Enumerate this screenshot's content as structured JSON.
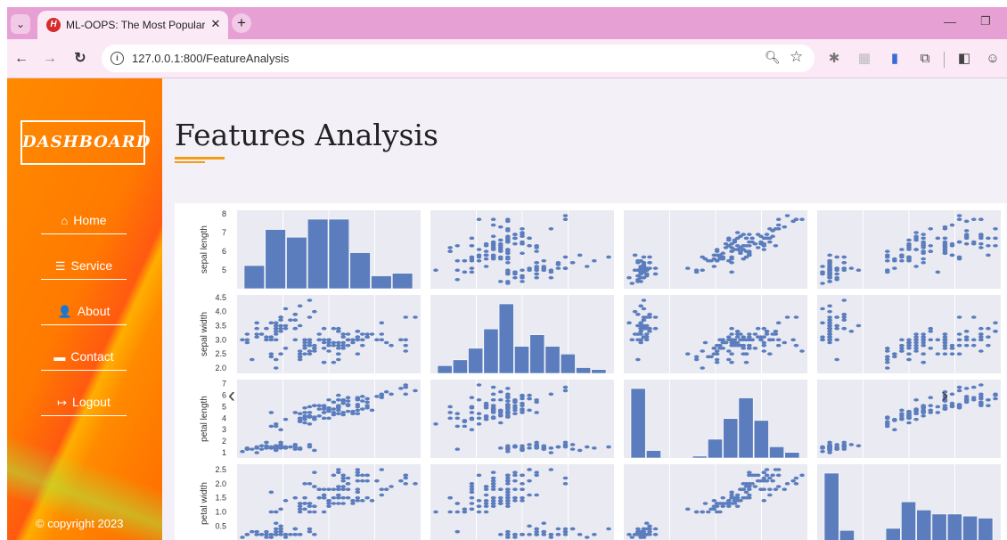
{
  "browser": {
    "tab_title": "ML-OOPS: The Most Popular V",
    "tab_close": "✕",
    "new_tab": "+",
    "url": "127.0.0.1:800/FeatureAnalysis"
  },
  "sidebar": {
    "logo": "DASHBOARD",
    "items": [
      {
        "label": "Home",
        "icon": "home-icon",
        "glyph": "⌂"
      },
      {
        "label": "Service",
        "icon": "list-icon",
        "glyph": "☰"
      },
      {
        "label": "About",
        "icon": "user-icon",
        "glyph": "👤"
      },
      {
        "label": "Contact",
        "icon": "chat-icon",
        "glyph": "▬"
      },
      {
        "label": "Logout",
        "icon": "logout-icon",
        "glyph": "↦"
      }
    ],
    "copyright": "© copyright 2023"
  },
  "main": {
    "title": "Features Analysis"
  },
  "colors": {
    "accent": "#f39c12",
    "marker": "#5b7dbd",
    "panel_bg": "#e9eaf2"
  },
  "chart_data": {
    "type": "scatter",
    "variables": [
      "sepal length",
      "sepal width",
      "petal length",
      "petal width"
    ],
    "ranges": [
      [
        4.3,
        7.9
      ],
      [
        2.0,
        4.4
      ],
      [
        1.0,
        6.9
      ],
      [
        0.1,
        2.5
      ]
    ],
    "ticks": {
      "sepal length": [
        "5",
        "6",
        "7",
        "8"
      ],
      "sepal width": [
        "2.0",
        "2.5",
        "3.0",
        "3.5",
        "4.0",
        "4.5"
      ],
      "petal length": [
        "1",
        "2",
        "3",
        "4",
        "5",
        "6",
        "7"
      ],
      "petal width": [
        "0.5",
        "1.0",
        "1.5",
        "2.0",
        "2.5"
      ]
    },
    "histograms": {
      "sepal length": [
        9,
        23,
        20,
        27,
        27,
        14,
        5,
        6
      ],
      "sepal width": [
        4,
        7,
        13,
        23,
        36,
        14,
        20,
        14,
        10,
        3,
        2
      ],
      "petal length": [
        37,
        4,
        0,
        0,
        1,
        10,
        21,
        32,
        20,
        6,
        3
      ],
      "petal width": [
        34,
        6,
        0,
        0,
        7,
        20,
        16,
        14,
        14,
        13,
        12
      ]
    },
    "samples": {
      "sepal length": [
        5.1,
        4.9,
        4.7,
        4.6,
        5.0,
        5.4,
        4.6,
        5.0,
        4.4,
        4.9,
        5.4,
        4.8,
        4.8,
        4.3,
        5.8,
        5.7,
        5.4,
        5.1,
        5.7,
        5.1,
        5.4,
        5.1,
        4.6,
        5.1,
        4.8,
        5.0,
        5.0,
        5.2,
        5.2,
        4.7,
        4.8,
        5.4,
        5.2,
        5.5,
        4.9,
        5.0,
        5.5,
        4.9,
        4.4,
        5.1,
        5.0,
        4.5,
        4.4,
        5.0,
        5.1,
        4.8,
        5.1,
        4.6,
        5.3,
        5.0,
        7.0,
        6.4,
        6.9,
        5.5,
        6.5,
        5.7,
        6.3,
        4.9,
        6.6,
        5.2,
        5.0,
        5.9,
        6.0,
        6.1,
        5.6,
        6.7,
        5.6,
        5.8,
        6.2,
        5.6,
        5.9,
        6.1,
        6.3,
        6.1,
        6.4,
        6.6,
        6.8,
        6.7,
        6.0,
        5.7,
        5.5,
        5.5,
        5.8,
        6.0,
        5.4,
        6.0,
        6.7,
        6.3,
        5.6,
        5.5,
        5.5,
        6.1,
        5.8,
        5.0,
        5.6,
        5.7,
        5.7,
        6.2,
        5.1,
        5.7,
        6.3,
        5.8,
        7.1,
        6.3,
        6.5,
        7.6,
        4.9,
        7.3,
        6.7,
        7.2,
        6.5,
        6.4,
        6.8,
        5.7,
        5.8,
        6.4,
        6.5,
        7.7,
        7.7,
        6.0,
        6.9,
        5.6,
        7.7,
        6.3,
        6.7,
        7.2,
        6.2,
        6.1,
        6.4,
        7.2,
        7.4,
        7.9,
        6.4,
        6.3,
        6.1,
        7.7,
        6.3,
        6.4,
        6.0,
        6.9,
        6.7,
        6.9,
        5.8,
        6.8,
        6.7,
        6.7,
        6.3,
        6.5,
        6.2,
        5.9
      ],
      "sepal width": [
        3.5,
        3.0,
        3.2,
        3.1,
        3.6,
        3.9,
        3.4,
        3.4,
        2.9,
        3.1,
        3.7,
        3.4,
        3.0,
        3.0,
        4.0,
        4.4,
        3.9,
        3.5,
        3.8,
        3.8,
        3.4,
        3.7,
        3.6,
        3.3,
        3.4,
        3.0,
        3.4,
        3.5,
        3.4,
        3.2,
        3.1,
        3.4,
        4.1,
        4.2,
        3.1,
        3.2,
        3.5,
        3.6,
        3.0,
        3.4,
        3.5,
        2.3,
        3.2,
        3.5,
        3.8,
        3.0,
        3.8,
        3.2,
        3.7,
        3.3,
        3.2,
        3.2,
        3.1,
        2.3,
        2.8,
        2.8,
        3.3,
        2.4,
        2.9,
        2.7,
        2.0,
        3.0,
        2.2,
        2.9,
        2.9,
        3.1,
        3.0,
        2.7,
        2.2,
        2.5,
        3.2,
        2.8,
        2.5,
        2.8,
        2.9,
        3.0,
        2.8,
        3.0,
        2.9,
        2.6,
        2.4,
        2.4,
        2.7,
        2.7,
        3.0,
        3.4,
        3.1,
        2.3,
        3.0,
        2.5,
        2.6,
        3.0,
        2.6,
        2.3,
        2.7,
        3.0,
        2.9,
        2.9,
        2.5,
        2.8,
        3.3,
        2.7,
        3.0,
        2.9,
        3.0,
        3.0,
        2.5,
        2.9,
        2.5,
        3.6,
        3.2,
        2.7,
        3.0,
        2.5,
        2.8,
        3.2,
        3.0,
        3.8,
        2.6,
        2.2,
        3.2,
        2.8,
        2.8,
        2.7,
        3.3,
        3.2,
        2.8,
        3.0,
        2.8,
        3.0,
        2.8,
        3.8,
        2.8,
        2.8,
        2.6,
        3.0,
        3.4,
        3.1,
        3.0,
        3.1,
        3.1,
        3.1,
        2.7,
        3.2,
        3.3,
        3.0,
        2.5,
        3.0,
        3.4,
        3.0
      ],
      "petal length": [
        1.4,
        1.4,
        1.3,
        1.5,
        1.4,
        1.7,
        1.4,
        1.5,
        1.4,
        1.5,
        1.5,
        1.6,
        1.4,
        1.1,
        1.2,
        1.5,
        1.3,
        1.4,
        1.7,
        1.5,
        1.7,
        1.5,
        1.0,
        1.7,
        1.9,
        1.6,
        1.6,
        1.5,
        1.4,
        1.6,
        1.6,
        1.5,
        1.5,
        1.4,
        1.5,
        1.2,
        1.3,
        1.4,
        1.3,
        1.5,
        1.3,
        1.3,
        1.3,
        1.6,
        1.9,
        1.4,
        1.6,
        1.4,
        1.5,
        1.4,
        4.7,
        4.5,
        4.9,
        4.0,
        4.6,
        4.5,
        4.7,
        3.3,
        4.6,
        3.9,
        3.5,
        4.2,
        4.0,
        4.7,
        3.6,
        4.4,
        4.5,
        4.1,
        4.5,
        3.9,
        4.8,
        4.0,
        4.9,
        4.7,
        4.3,
        4.4,
        4.8,
        5.0,
        4.5,
        3.5,
        3.8,
        3.7,
        3.9,
        5.1,
        4.5,
        4.5,
        4.7,
        4.4,
        4.1,
        4.0,
        4.4,
        4.6,
        4.0,
        3.3,
        4.2,
        4.2,
        4.2,
        4.3,
        3.0,
        4.1,
        6.0,
        5.1,
        5.9,
        5.6,
        5.8,
        6.6,
        4.5,
        6.3,
        5.8,
        6.1,
        5.1,
        5.3,
        5.5,
        5.0,
        5.1,
        5.3,
        5.5,
        6.7,
        6.9,
        5.0,
        5.7,
        4.9,
        6.7,
        4.9,
        5.7,
        6.0,
        4.8,
        4.9,
        5.6,
        5.8,
        6.1,
        6.4,
        5.6,
        5.1,
        5.6,
        6.1,
        5.6,
        5.5,
        4.8,
        5.4,
        5.6,
        5.1,
        5.1,
        5.9,
        5.7,
        5.2,
        5.0,
        5.2,
        5.4,
        5.1
      ],
      "petal width": [
        0.2,
        0.2,
        0.2,
        0.2,
        0.2,
        0.4,
        0.3,
        0.2,
        0.2,
        0.1,
        0.2,
        0.2,
        0.1,
        0.1,
        0.2,
        0.4,
        0.4,
        0.3,
        0.3,
        0.3,
        0.2,
        0.4,
        0.2,
        0.5,
        0.2,
        0.2,
        0.4,
        0.2,
        0.2,
        0.2,
        0.2,
        0.4,
        0.1,
        0.2,
        0.2,
        0.2,
        0.2,
        0.1,
        0.2,
        0.2,
        0.3,
        0.3,
        0.2,
        0.6,
        0.4,
        0.3,
        0.2,
        0.2,
        0.2,
        0.2,
        1.4,
        1.5,
        1.5,
        1.3,
        1.5,
        1.3,
        1.6,
        1.0,
        1.3,
        1.4,
        1.0,
        1.5,
        1.0,
        1.4,
        1.3,
        1.4,
        1.5,
        1.0,
        1.5,
        1.1,
        1.8,
        1.3,
        1.5,
        1.2,
        1.3,
        1.4,
        1.4,
        1.7,
        1.5,
        1.0,
        1.1,
        1.0,
        1.2,
        1.6,
        1.5,
        1.6,
        1.5,
        1.3,
        1.3,
        1.3,
        1.2,
        1.4,
        1.2,
        1.0,
        1.3,
        1.2,
        1.3,
        1.3,
        1.1,
        1.3,
        2.5,
        1.9,
        2.1,
        1.8,
        2.2,
        2.1,
        1.7,
        1.8,
        1.8,
        2.5,
        2.0,
        1.9,
        2.1,
        2.0,
        2.4,
        2.3,
        1.8,
        2.2,
        2.3,
        1.5,
        2.3,
        2.0,
        2.0,
        1.8,
        2.1,
        1.8,
        1.8,
        1.8,
        2.1,
        1.6,
        1.9,
        2.0,
        2.2,
        1.5,
        1.4,
        2.3,
        2.4,
        1.8,
        1.8,
        2.1,
        2.4,
        2.3,
        1.9,
        2.3,
        2.5,
        2.3,
        1.9,
        2.0,
        2.3,
        1.8
      ]
    }
  },
  "carousel": {
    "prev": "‹",
    "next": "›"
  }
}
